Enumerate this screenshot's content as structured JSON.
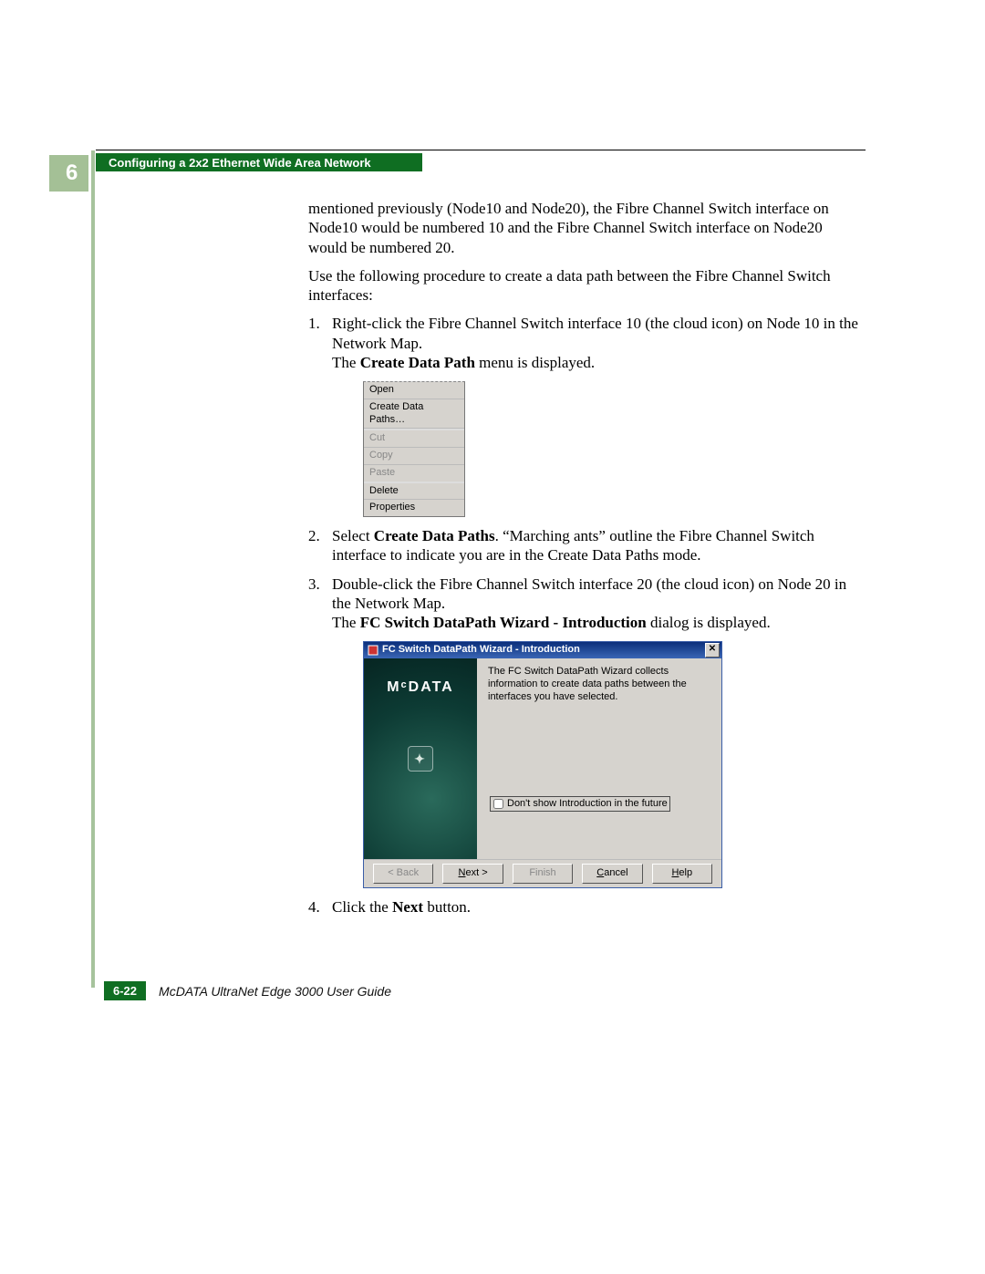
{
  "header": {
    "chapter_number": "6",
    "header_title": "Configuring a 2x2 Ethernet Wide Area Network"
  },
  "body": {
    "p_intro": "mentioned previously (Node10 and Node20), the Fibre Channel Switch interface on Node10 would be numbered 10 and the Fibre Channel Switch interface on Node20 would be numbered 20.",
    "p_use": "Use the following procedure to create a data path between the Fibre Channel Switch interfaces:",
    "step1": "Right-click the Fibre Channel Switch interface 10 (the cloud icon) on Node 10 in the Network Map.",
    "step1_after_pre": "The ",
    "step1_after_bold": "Create Data Path",
    "step1_after_post": " menu is displayed.",
    "step2_pre": "Select ",
    "step2_bold": "Create Data Paths",
    "step2_post": ". “Marching ants” outline the Fibre Channel Switch interface to indicate you are in the Create Data Paths mode.",
    "step3": "Double-click the Fibre Channel Switch interface 20 (the cloud icon) on Node 20 in the Network Map.",
    "step3_after_pre": "The ",
    "step3_after_bold": "FC Switch DataPath Wizard - Introduction",
    "step3_after_post": " dialog is displayed.",
    "step4_pre": "Click the ",
    "step4_bold": "Next",
    "step4_post": " button."
  },
  "context_menu": {
    "open": "Open",
    "create": "Create Data Paths…",
    "cut": "Cut",
    "copy": "Copy",
    "paste": "Paste",
    "delete": "Delete",
    "properties": "Properties"
  },
  "dialog": {
    "title": "FC Switch DataPath Wizard - Introduction",
    "brand": "MᶜDATA",
    "description": "The FC Switch DataPath Wizard collects information to create data paths between the interfaces you have selected.",
    "dontshow": "Don't show Introduction in the future",
    "back": "< Back",
    "next": "Next >",
    "finish": "Finish",
    "cancel": "Cancel",
    "help": "Help"
  },
  "footer": {
    "page_number": "6-22",
    "doc_title": "McDATA UltraNet Edge 3000 User Guide"
  }
}
